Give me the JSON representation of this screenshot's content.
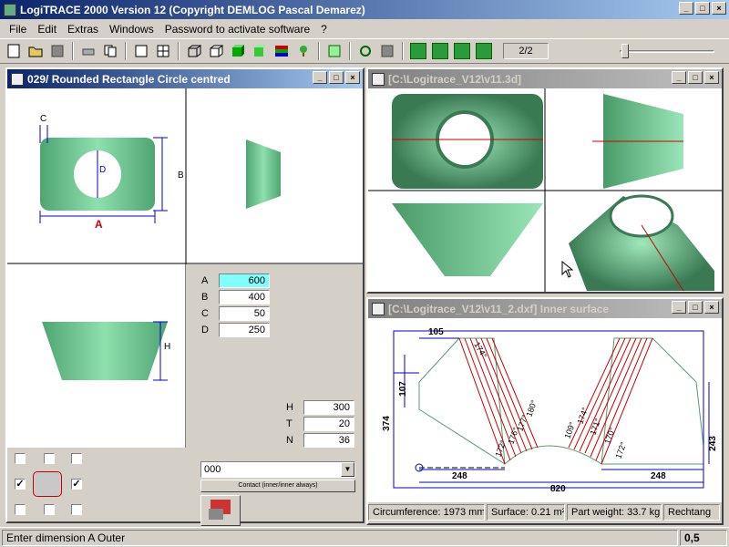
{
  "app": {
    "title": "LogiTRACE 2000  Version 12  (Copyright DEMLOG Pascal Demarez)"
  },
  "menu": [
    "File",
    "Edit",
    "Extras",
    "Windows",
    "Password to activate software",
    "?"
  ],
  "toolbar": {
    "page": "2/2"
  },
  "left_window": {
    "title": "029/ Rounded Rectangle Circle centred",
    "dim_labels": {
      "C": "C",
      "D": "D",
      "B": "B",
      "A": "A",
      "H": "H"
    },
    "fields": [
      {
        "label": "A",
        "value": "600"
      },
      {
        "label": "B",
        "value": "400"
      },
      {
        "label": "C",
        "value": "50"
      },
      {
        "label": "D",
        "value": "250"
      }
    ],
    "fields2": [
      {
        "label": "H",
        "value": "300"
      },
      {
        "label": "T",
        "value": "20"
      },
      {
        "label": "N",
        "value": "36"
      }
    ],
    "combo_value": "000",
    "contact_label": "Contact (inner/inner always)"
  },
  "view3d": {
    "title": "[C:\\Logitrace_V12\\v11.3d]"
  },
  "dxf": {
    "title": "[C:\\Logitrace_V12\\v11_2.dxf]  Inner surface",
    "dims": {
      "d105": "105",
      "d107": "107",
      "d374": "374",
      "d243": "243",
      "d248a": "248",
      "d248b": "248",
      "d820": "820"
    },
    "angle_left": [
      "174°",
      "180°",
      "177°",
      "176°",
      "172°",
      "171°",
      "172°",
      "173°",
      "172°",
      "173°",
      "174°"
    ],
    "angle_right": [
      "109°",
      "174°",
      "171°",
      "170°",
      "172°",
      "172°",
      "171°",
      "172°",
      "171°",
      "173°",
      "174°"
    ],
    "circumference": "Circumference: 1973 mm",
    "surface": "Surface: 0.21 m²",
    "weight": "Part weight: 33.7 kg",
    "shape": "Rechtang"
  },
  "status": {
    "message": "Enter dimension A Outer",
    "value": "0,5"
  },
  "colors": {
    "active_title": "#0a246a",
    "shape_fill": "#7ccf99",
    "dim_line": "#0000cc",
    "red": "#cc0000"
  }
}
